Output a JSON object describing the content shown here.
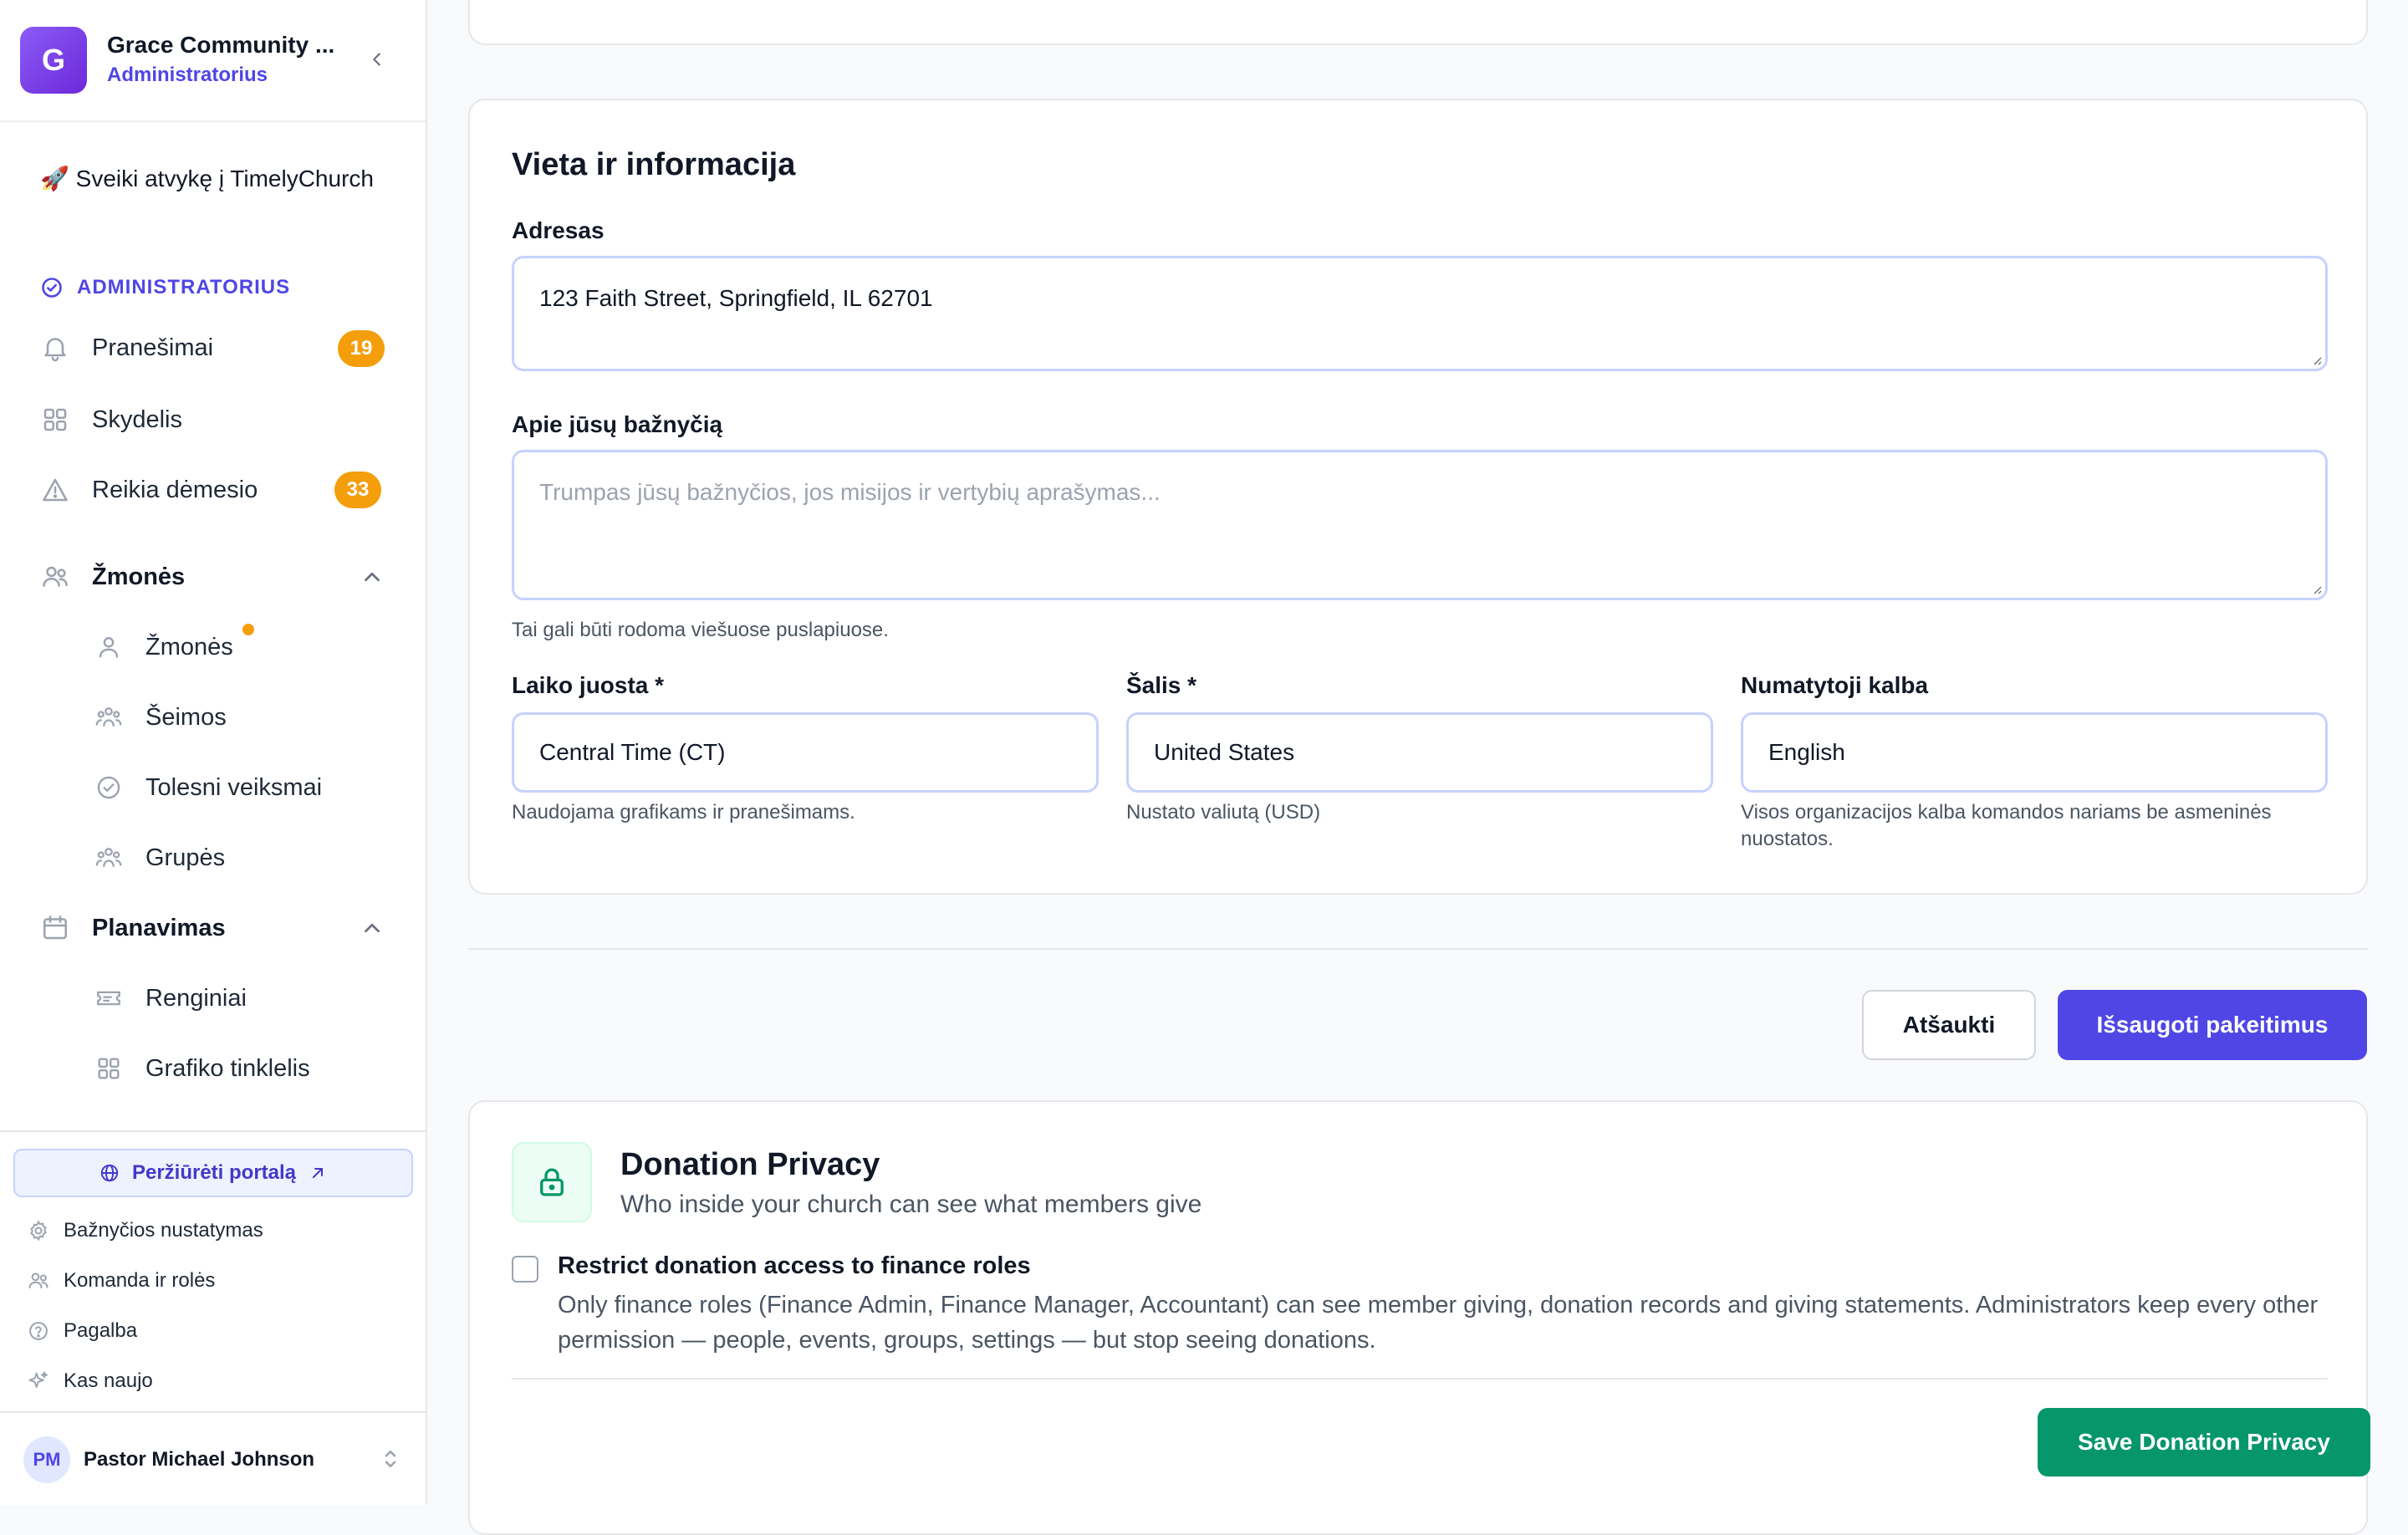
{
  "sidebar": {
    "org_initial": "G",
    "org_name": "Grace Community ...",
    "org_role": "Administratorius",
    "welcome": "🚀 Sveiki atvykę į TimelyChurch",
    "section_admin": "ADMINISTRATORIUS",
    "nav": {
      "notifications": {
        "label": "Pranešimai",
        "badge": "19"
      },
      "dashboard": {
        "label": "Skydelis"
      },
      "attention": {
        "label": "Reikia dėmesio",
        "badge": "33"
      },
      "people_group": {
        "label": "Žmonės"
      },
      "people": {
        "label": "Žmonės"
      },
      "families": {
        "label": "Šeimos"
      },
      "followups": {
        "label": "Tolesni veiksmai"
      },
      "groups": {
        "label": "Grupės"
      },
      "planning_group": {
        "label": "Planavimas"
      },
      "events": {
        "label": "Renginiai"
      },
      "schedule_grid": {
        "label": "Grafiko tinklelis"
      }
    },
    "portal_button": "Peržiūrėti portalą",
    "bottom_links": {
      "church_settings": "Bažnyčios nustatymas",
      "team_roles": "Komanda ir rolės",
      "help": "Pagalba",
      "whats_new": "Kas naujo"
    },
    "user": {
      "initials": "PM",
      "name": "Pastor Michael Johnson"
    }
  },
  "location_card": {
    "title": "Vieta ir informacija",
    "address_label": "Adresas",
    "address_value": "123 Faith Street, Springfield, IL 62701",
    "about_label": "Apie jūsų bažnyčią",
    "about_placeholder": "Trumpas jūsų bažnyčios, jos misijos ir vertybių aprašymas...",
    "about_hint": "Tai gali būti rodoma viešuose puslapiuose.",
    "timezone_label": "Laiko juosta *",
    "timezone_value": "Central Time (CT)",
    "timezone_hint": "Naudojama grafikams ir pranešimams.",
    "country_label": "Šalis *",
    "country_value": "United States",
    "country_hint": "Nustato valiutą (USD)",
    "language_label": "Numatytoji kalba",
    "language_value": "English",
    "language_hint": "Visos organizacijos kalba komandos nariams be asmeninės nuostatos."
  },
  "actions": {
    "cancel": "Atšaukti",
    "save": "Išsaugoti pakeitimus"
  },
  "donation_privacy": {
    "title": "Donation Privacy",
    "subtitle": "Who inside your church can see what members give",
    "checkbox_label": "Restrict donation access to finance roles",
    "checkbox_description": "Only finance roles (Finance Admin, Finance Manager, Accountant) can see member giving, donation records and giving statements. Administrators keep every other permission — people, events, groups, settings — but stop seeing donations.",
    "save_button": "Save Donation Privacy"
  },
  "colors": {
    "primary": "#4f46e5",
    "badge": "#f59e0b",
    "success": "#059669",
    "field_border": "#c7d2fe"
  }
}
